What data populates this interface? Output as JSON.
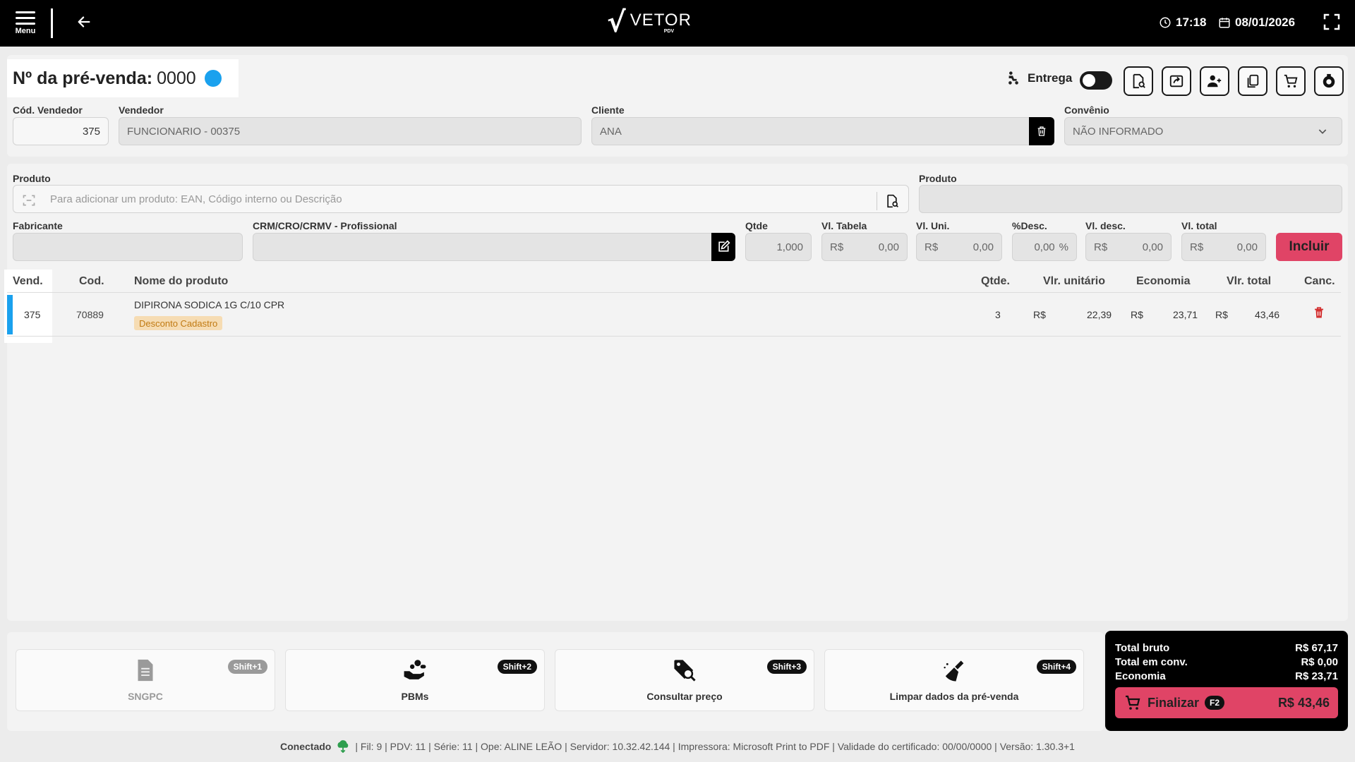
{
  "topbar": {
    "menu_label": "Menu",
    "logo_main": "VETOR",
    "logo_sub": "PDV",
    "time": "17:18",
    "date": "08/01/2026"
  },
  "header": {
    "presale_label": "Nº da pré-venda:",
    "presale_number": "0000",
    "delivery_label": "Entrega",
    "seller_code_label": "Cód. Vendedor",
    "seller_code": "375",
    "seller_label": "Vendedor",
    "seller": "FUNCIONARIO - 00375",
    "client_label": "Cliente",
    "client": "ANA",
    "agreement_label": "Convênio",
    "agreement": "NÃO INFORMADO"
  },
  "product_form": {
    "product_label": "Produto",
    "product_placeholder": "Para adicionar um produto: EAN, Código interno ou Descrição",
    "product_label_2": "Produto",
    "manufacturer_label": "Fabricante",
    "professional_label": "CRM/CRO/CRMV - Profissional",
    "qty_label": "Qtde",
    "qty": "1,000",
    "table_price_label": "Vl. Tabela",
    "unit_price_label": "Vl. Uni.",
    "disc_pct_label": "%Desc.",
    "disc_value_label": "Vl. desc.",
    "total_label": "Vl. total",
    "currency": "R$",
    "zero": "0,00",
    "pct_sign": "%",
    "include_label": "Incluir"
  },
  "table": {
    "headers": {
      "vend": "Vend.",
      "cod": "Cod.",
      "name": "Nome do produto",
      "qty": "Qtde.",
      "unit": "Vlr. unitário",
      "saving": "Economia",
      "total": "Vlr. total",
      "cancel": "Canc."
    },
    "rows": [
      {
        "vend": "375",
        "cod": "70889",
        "name": "DIPIRONA SODICA 1G C/10 CPR",
        "badge": "Desconto Cadastro",
        "qty": "3",
        "currency": "R$",
        "unit": "22,39",
        "saving": "23,71",
        "total": "43,46"
      }
    ]
  },
  "actions": [
    {
      "label": "SNGPC",
      "key": "Shift+1"
    },
    {
      "label": "PBMs",
      "key": "Shift+2"
    },
    {
      "label": "Consultar preço",
      "key": "Shift+3"
    },
    {
      "label": "Limpar dados da pré-venda",
      "key": "Shift+4"
    }
  ],
  "totals": {
    "gross_label": "Total bruto",
    "gross": "R$ 67,17",
    "agreement_label": "Total em conv.",
    "agreement": "R$ 0,00",
    "saving_label": "Economia",
    "saving": "R$ 23,71",
    "finish_label": "Finalizar",
    "finish_key": "F2",
    "finish_amount": "R$ 43,46"
  },
  "status": {
    "connected": "Conectado",
    "details": "| Fil: 9 | PDV: 11 | Série: 11 | Ope: ALINE LEÃO | Servidor: 10.32.42.144 | Impressora: Microsoft Print to PDF | Validade do certificado: 00/00/0000 | Versão: 1.30.3+1"
  },
  "colors": {
    "accent_blue": "#1aa1ee",
    "accent_pink": "#e04466",
    "badge_bg": "#f6dcb3",
    "cancel_red": "#d32f2f",
    "connected_green": "#2e9e4e"
  }
}
